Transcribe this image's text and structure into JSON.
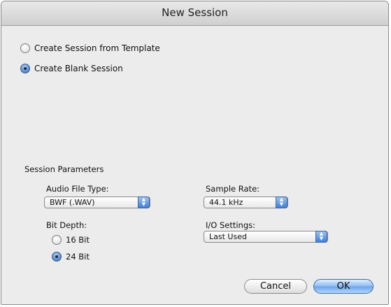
{
  "window": {
    "title": "New Session"
  },
  "session_options": [
    {
      "label": "Create Session from Template",
      "selected": false
    },
    {
      "label": "Create Blank Session",
      "selected": true
    }
  ],
  "parameters": {
    "section_title": "Session Parameters",
    "audio_file_type": {
      "label": "Audio File Type:",
      "value": "BWF (.WAV)"
    },
    "sample_rate": {
      "label": "Sample Rate:",
      "value": "44.1 kHz"
    },
    "bit_depth": {
      "label": "Bit Depth:",
      "options": [
        {
          "label": "16 Bit",
          "selected": false
        },
        {
          "label": "24 Bit",
          "selected": true
        }
      ]
    },
    "io_settings": {
      "label": "I/O Settings:",
      "value": "Last Used"
    }
  },
  "buttons": {
    "cancel": "Cancel",
    "ok": "OK"
  }
}
